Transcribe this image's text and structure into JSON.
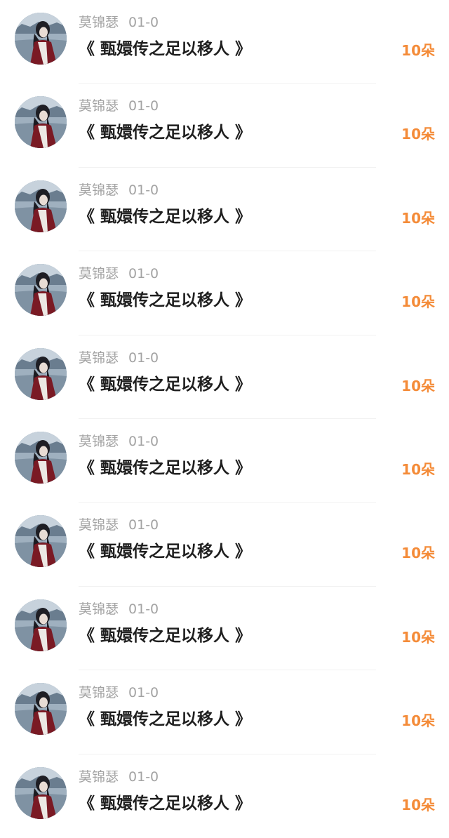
{
  "items": [
    {
      "user": "莫锦瑟",
      "time": "01-0",
      "title": "《 甄嬛传之足以移人 》",
      "gift": "10朵"
    },
    {
      "user": "莫锦瑟",
      "time": "01-0",
      "title": "《 甄嬛传之足以移人 》",
      "gift": "10朵"
    },
    {
      "user": "莫锦瑟",
      "time": "01-0",
      "title": "《 甄嬛传之足以移人 》",
      "gift": "10朵"
    },
    {
      "user": "莫锦瑟",
      "time": "01-0",
      "title": "《 甄嬛传之足以移人 》",
      "gift": "10朵"
    },
    {
      "user": "莫锦瑟",
      "time": "01-0",
      "title": "《 甄嬛传之足以移人 》",
      "gift": "10朵"
    },
    {
      "user": "莫锦瑟",
      "time": "01-0",
      "title": "《 甄嬛传之足以移人 》",
      "gift": "10朵"
    },
    {
      "user": "莫锦瑟",
      "time": "01-0",
      "title": "《 甄嬛传之足以移人 》",
      "gift": "10朵"
    },
    {
      "user": "莫锦瑟",
      "time": "01-0",
      "title": "《 甄嬛传之足以移人 》",
      "gift": "10朵"
    },
    {
      "user": "莫锦瑟",
      "time": "01-0",
      "title": "《 甄嬛传之足以移人 》",
      "gift": "10朵"
    },
    {
      "user": "莫锦瑟",
      "time": "01-0",
      "title": "《 甄嬛传之足以移人 》",
      "gift": "10朵"
    }
  ]
}
